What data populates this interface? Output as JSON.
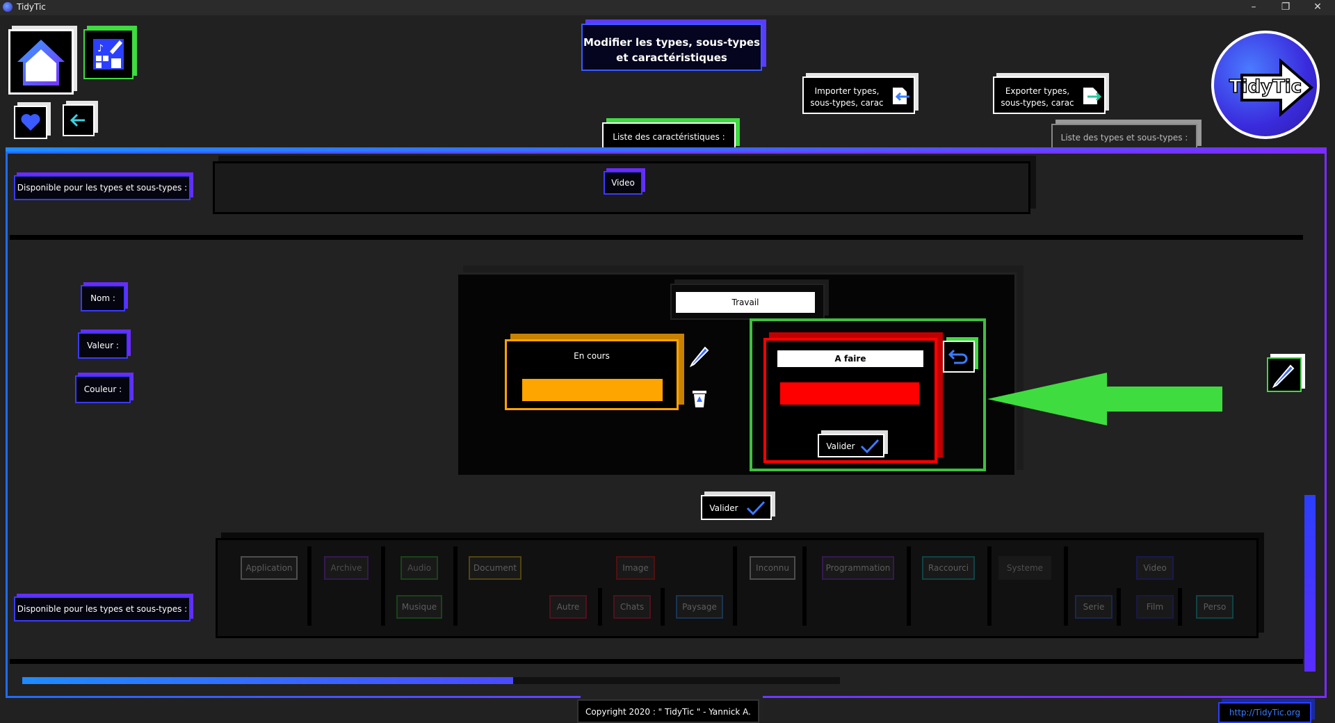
{
  "window": {
    "title": "TidyTic",
    "controls": [
      "–",
      "❐",
      "✕"
    ]
  },
  "header": {
    "title_line1": "Modifier les types, sous-types",
    "title_line2": "et caractéristiques",
    "import_line1": "Importer types,",
    "import_line2": "sous-types, carac",
    "export_line1": "Exporter types,",
    "export_line2": "sous-types, carac",
    "logo_text": "TidyTic"
  },
  "tabs": {
    "characteristics": "Liste des caractéristiques :",
    "types": "Liste des types et sous-types :"
  },
  "sidebar_labels": {
    "available_top": "Disponible pour les types et sous-types :",
    "available_bottom": "Disponible pour les types et sous-types :",
    "name": "Nom :",
    "value": "Valeur :",
    "color": "Couleur :"
  },
  "top_row": {
    "chip": "Video"
  },
  "editor": {
    "name_value": "Travail",
    "left_card": {
      "title": "En cours",
      "color": "#ffa500"
    },
    "right_card": {
      "title": "A faire",
      "color": "#ff0000",
      "validate": "Valider"
    },
    "validate": "Valider"
  },
  "type_chips": {
    "row1": [
      "Application",
      "Archive",
      "Audio",
      "Document",
      "Image",
      "Inconnu",
      "Programmation",
      "Raccourci",
      "Systeme",
      "Video"
    ],
    "row2": [
      "Musique",
      "Autre",
      "Chats",
      "Paysage",
      "Serie",
      "Film",
      "Perso"
    ]
  },
  "progress": {
    "value": 0.6
  },
  "footer": {
    "copyright": "Copyright 2020 : \" TidyTic \" - Yannick A.",
    "url": "http://TidyTic.org"
  },
  "colors": {
    "accent_blue": "#1f6cff",
    "accent_purple": "#7a2cff",
    "green": "#3fdc3f",
    "orange": "#ffa500",
    "red": "#ff0000"
  }
}
